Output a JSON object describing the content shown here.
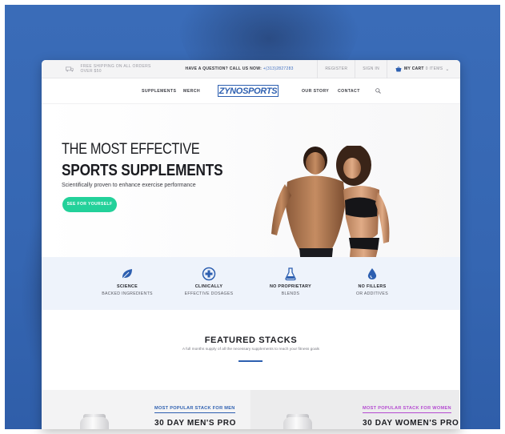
{
  "topbar": {
    "shipping": "FREE SHIPPING ON ALL ORDERS OVER $50",
    "question": "HAVE A QUESTION? CALL US NOW:",
    "phone": "+(313)2827283",
    "register": "REGISTER",
    "signin": "SIGN IN",
    "cart_label": "MY CART",
    "cart_count": "0 ITEMS"
  },
  "nav": {
    "supplements": "SUPPLEMENTS",
    "merch": "MERCH",
    "logo_part1": "ZYNO",
    "logo_part2": "SPORTS",
    "our_story": "OUR STORY",
    "contact": "CONTACT"
  },
  "hero": {
    "line1": "THE MOST EFFECTIVE",
    "line2": "SPORTS SUPPLEMENTS",
    "subtitle": "Scientifically proven to enhance exercise performance",
    "cta": "SEE FOR YOURSELF"
  },
  "features": [
    {
      "title": "SCIENCE",
      "subtitle": "BACKED INGREDIENTS",
      "icon": "leaf-icon"
    },
    {
      "title": "CLINICALLY",
      "subtitle": "EFFECTIVE DOSAGES",
      "icon": "medical-cross-icon"
    },
    {
      "title": "NO PROPRIETARY",
      "subtitle": "BLENDS",
      "icon": "flask-icon"
    },
    {
      "title": "NO FILLERS",
      "subtitle": "OR ADDITIVES",
      "icon": "drop-icon"
    }
  ],
  "featured": {
    "title": "FEATURED STACKS",
    "description": "A full months supply of all the necessary supplements to reach your fitness goals"
  },
  "stacks": [
    {
      "tag": "MOST POPULAR STACK FOR MEN",
      "name": "30 DAY MEN'S PRO",
      "tag_color": "#2d5fb0"
    },
    {
      "tag": "MOST POPULAR STACK FOR WOMEN",
      "name": "30 DAY WOMEN'S PRO",
      "tag_color": "#b44ad1"
    }
  ],
  "colors": {
    "brand_blue": "#2d5fb0",
    "cta_green": "#23d19a",
    "background_blue": "#3566b2"
  }
}
